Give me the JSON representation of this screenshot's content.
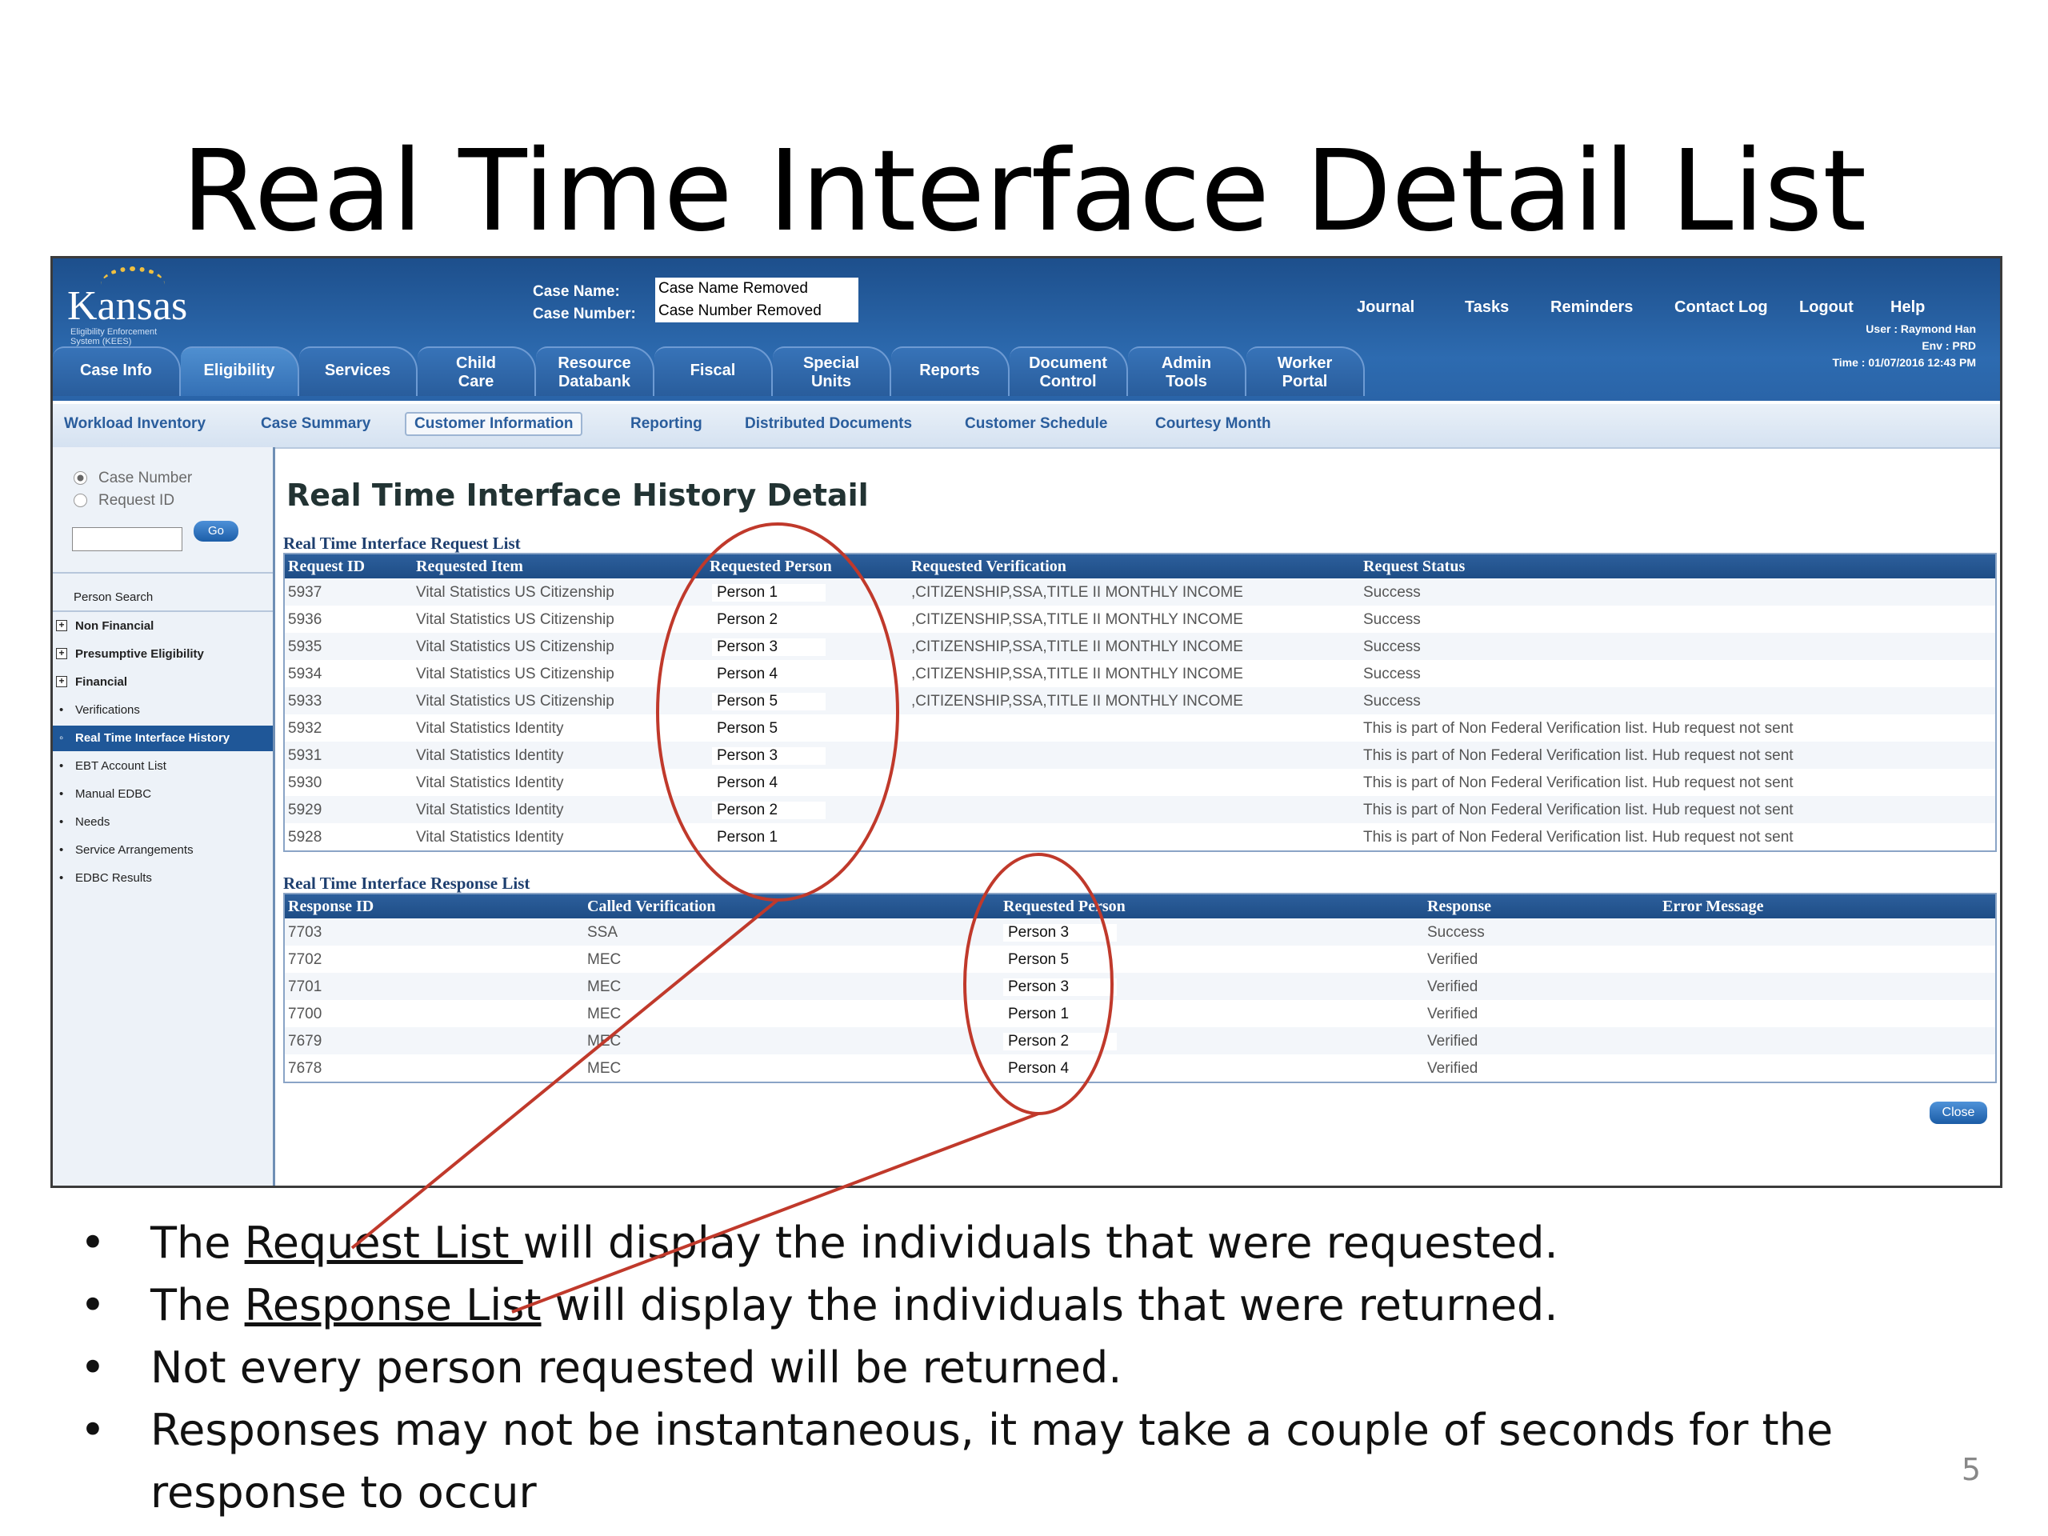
{
  "slide": {
    "title": "Real Time Interface Detail List",
    "page_number": "5",
    "bullets": [
      {
        "pre": "The ",
        "link": "Request List ",
        "post": "will display the individuals that were requested."
      },
      {
        "pre": "The ",
        "link": "Response List",
        "post": " will display the individuals that were returned."
      },
      {
        "pre": "Not every person requested will be returned.",
        "link": "",
        "post": ""
      },
      {
        "pre": "Responses may not be instantaneous, it may take a couple of seconds for the response to occur",
        "link": "",
        "post": ""
      }
    ],
    "annotation_color": "#c0392b"
  },
  "app": {
    "logo": "Kansas",
    "logo_sub": "Eligibility Enforcement System (KEES)",
    "case_name_label": "Case Name:",
    "case_number_label": "Case Number:",
    "case_name_value": "Case Name Removed",
    "case_number_value": "Case Number Removed",
    "top_links": [
      "Journal",
      "Tasks",
      "Reminders",
      "Contact Log",
      "Logout",
      "Help"
    ],
    "user": "User : Raymond Han",
    "env": "Env : PRD",
    "time": "Time : 01/07/2016 12:43 PM",
    "tabs": [
      {
        "label": "Case Info"
      },
      {
        "label": "Eligibility"
      },
      {
        "label": "Services"
      },
      {
        "label": "Child\nCare"
      },
      {
        "label": "Resource\nDatabank"
      },
      {
        "label": "Fiscal"
      },
      {
        "label": "Special\nUnits"
      },
      {
        "label": "Reports"
      },
      {
        "label": "Document\nControl"
      },
      {
        "label": "Admin\nTools"
      },
      {
        "label": "Worker\nPortal"
      }
    ],
    "subnav": [
      "Workload Inventory",
      "Case Summary",
      "Customer Information",
      "Reporting",
      "Distributed Documents",
      "Customer Schedule",
      "Courtesy Month"
    ],
    "sidebar": {
      "radio_case_number": "Case Number",
      "radio_request_id": "Request ID",
      "go": "Go",
      "items": [
        "Person Search",
        "Non Financial",
        "Presumptive Eligibility",
        "Financial",
        "Verifications",
        "Real Time Interface History",
        "EBT Account List",
        "Manual EDBC",
        "Needs",
        "Service Arrangements",
        "EDBC Results"
      ]
    },
    "page_heading": "Real Time Interface History Detail",
    "request_list": {
      "title": "Real Time Interface Request List",
      "headers": [
        "Request ID",
        "Requested Item",
        "Requested Person",
        "Requested Verification",
        "Request Status"
      ],
      "rows": [
        [
          "5937",
          "Vital Statistics US Citizenship",
          "Person 1",
          ",CITIZENSHIP,SSA,TITLE II MONTHLY INCOME",
          "Success"
        ],
        [
          "5936",
          "Vital Statistics US Citizenship",
          "Person 2",
          ",CITIZENSHIP,SSA,TITLE II MONTHLY INCOME",
          "Success"
        ],
        [
          "5935",
          "Vital Statistics US Citizenship",
          "Person 3",
          ",CITIZENSHIP,SSA,TITLE II MONTHLY INCOME",
          "Success"
        ],
        [
          "5934",
          "Vital Statistics US Citizenship",
          "Person 4",
          ",CITIZENSHIP,SSA,TITLE II MONTHLY INCOME",
          "Success"
        ],
        [
          "5933",
          "Vital Statistics US Citizenship",
          "Person 5",
          ",CITIZENSHIP,SSA,TITLE II MONTHLY INCOME",
          "Success"
        ],
        [
          "5932",
          "Vital Statistics Identity",
          "Person 5",
          "",
          "This is part of Non Federal Verification list. Hub request not sent"
        ],
        [
          "5931",
          "Vital Statistics Identity",
          "Person 3",
          "",
          "This is part of Non Federal Verification list. Hub request not sent"
        ],
        [
          "5930",
          "Vital Statistics Identity",
          "Person 4",
          "",
          "This is part of Non Federal Verification list. Hub request not sent"
        ],
        [
          "5929",
          "Vital Statistics Identity",
          "Person 2",
          "",
          "This is part of Non Federal Verification list. Hub request not sent"
        ],
        [
          "5928",
          "Vital Statistics Identity",
          "Person 1",
          "",
          "This is part of Non Federal Verification list. Hub request not sent"
        ]
      ]
    },
    "response_list": {
      "title": "Real Time Interface Response List",
      "headers": [
        "Response ID",
        "Called Verification",
        "Requested Person",
        "Response",
        "Error Message"
      ],
      "rows": [
        [
          "7703",
          "SSA",
          "Person 3",
          "Success",
          ""
        ],
        [
          "7702",
          "MEC",
          "Person 5",
          "Verified",
          ""
        ],
        [
          "7701",
          "MEC",
          "Person 3",
          "Verified",
          ""
        ],
        [
          "7700",
          "MEC",
          "Person 1",
          "Verified",
          ""
        ],
        [
          "7679",
          "MEC",
          "Person 2",
          "Verified",
          ""
        ],
        [
          "7678",
          "MEC",
          "Person 4",
          "Verified",
          ""
        ]
      ]
    },
    "close": "Close"
  }
}
